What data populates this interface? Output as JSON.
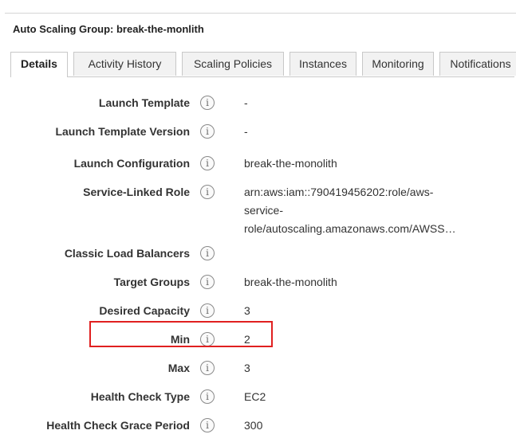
{
  "header": {
    "title": "Auto Scaling Group: break-the-monlith"
  },
  "tabs": [
    {
      "label": "Details",
      "active": true
    },
    {
      "label": "Activity History",
      "active": false
    },
    {
      "label": "Scaling Policies",
      "active": false
    },
    {
      "label": "Instances",
      "active": false
    },
    {
      "label": "Monitoring",
      "active": false
    },
    {
      "label": "Notifications",
      "active": false
    }
  ],
  "info_icon": {
    "glyph": "i",
    "icon": "info-icon"
  },
  "details": [
    {
      "label": "Launch Template",
      "value": "-"
    },
    {
      "label": "Launch Template Version",
      "value": "-"
    },
    {
      "label": "Launch Configuration",
      "value": "break-the-monolith"
    },
    {
      "label": "Service-Linked Role",
      "value_lines": [
        "arn:aws:iam::790419456202:role/aws-",
        "service-",
        "role/autoscaling.amazonaws.com/AWSS…"
      ]
    },
    {
      "label": "Classic Load Balancers",
      "value": ""
    },
    {
      "label": "Target Groups",
      "value": "break-the-monolith"
    },
    {
      "label": "Desired Capacity",
      "value": "3"
    },
    {
      "label": "Min",
      "value": "2"
    },
    {
      "label": "Max",
      "value": "3"
    },
    {
      "label": "Health Check Type",
      "value": "EC2"
    },
    {
      "label": "Health Check Grace Period",
      "value": "300"
    }
  ],
  "highlight": {
    "target": "Min",
    "color": "#e02020"
  }
}
